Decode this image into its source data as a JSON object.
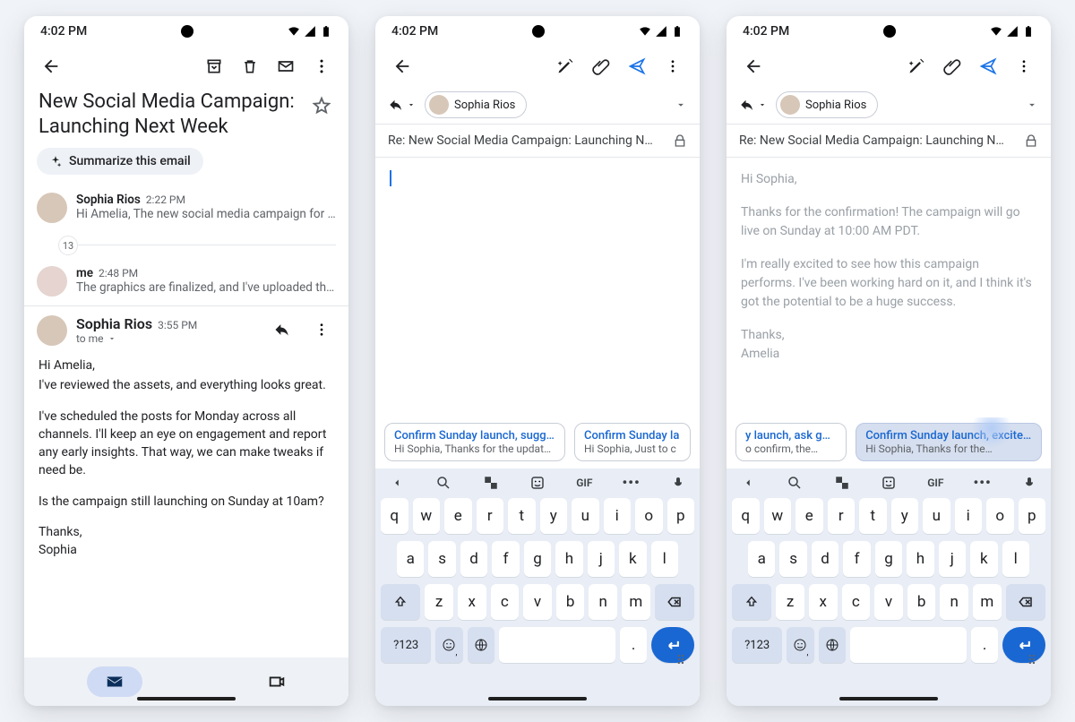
{
  "status": {
    "time": "4:02 PM"
  },
  "phone1": {
    "subject": "New Social Media Campaign: Launching Next Week",
    "summary_chip": "Summarize this email",
    "messages": [
      {
        "sender": "Sophia Rios",
        "time": "2:22 PM",
        "preview": "Hi Amelia, The new social media campaign for ou…"
      },
      {
        "sender": "me",
        "time": "2:48 PM",
        "preview": "The graphics are finalized, and I've uploaded the…"
      }
    ],
    "thread_count": "13",
    "expanded": {
      "sender": "Sophia Rios",
      "time": "3:55 PM",
      "to": "to me",
      "body": [
        "Hi Amelia,",
        "I've reviewed the assets, and everything looks great.",
        "I've scheduled the posts for Monday across all channels. I'll keep an eye on engagement and report any early insights. That way, we can make tweaks if need be.",
        "Is the campaign still launching on Sunday at 10am?",
        "Thanks,\nSophia"
      ]
    }
  },
  "phone2": {
    "recipient": "Sophia Rios",
    "subject": "Re: New Social Media Campaign: Launching N…",
    "suggestions": [
      {
        "title": "Confirm Sunday launch, sugge…",
        "sub": "Hi Sophia, Thanks for the updat…"
      },
      {
        "title": "Confirm Sunday la",
        "sub": "Hi Sophia, Just to c"
      }
    ]
  },
  "phone3": {
    "recipient": "Sophia Rios",
    "subject": "Re: New Social Media Campaign: Launching N…",
    "body": [
      "Hi Sophia,",
      "Thanks for the confirmation! The campaign will go live on Sunday at 10:00 AM PDT.",
      "I'm really excited to see how this campaign performs. I've been working hard on it, and I think it's got the potential to be a huge success.",
      "Thanks,",
      "Amelia"
    ],
    "suggestions": [
      {
        "title": "y launch, ask goals",
        "sub": "o confirm, the…"
      },
      {
        "title": "Confirm Sunday launch, excited.",
        "sub": "Hi Sophia, Thanks for the…"
      }
    ]
  },
  "keyboard": {
    "row1": [
      "q",
      "w",
      "e",
      "r",
      "t",
      "y",
      "u",
      "i",
      "o",
      "p"
    ],
    "row2": [
      "a",
      "s",
      "d",
      "f",
      "g",
      "h",
      "j",
      "k",
      "l"
    ],
    "row3": [
      "z",
      "x",
      "c",
      "v",
      "b",
      "n",
      "m"
    ],
    "num": "?123",
    "comma": ",",
    "period": ".",
    "gif": "GIF"
  }
}
